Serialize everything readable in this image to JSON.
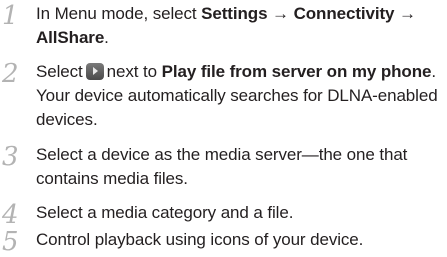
{
  "steps": [
    {
      "number": "1",
      "segments": [
        {
          "text": "In Menu mode, select ",
          "bold": false
        },
        {
          "text": "Settings",
          "bold": true
        },
        {
          "text": " → ",
          "bold": false
        },
        {
          "text": "Connectivity",
          "bold": true
        },
        {
          "text": " → ",
          "bold": false
        },
        {
          "text": "AllShare",
          "bold": true
        },
        {
          "text": ".",
          "bold": false
        }
      ]
    },
    {
      "number": "2",
      "segments": [
        {
          "text": "Select",
          "bold": false
        },
        {
          "icon": "play-arrow-icon"
        },
        {
          "text": "next to ",
          "bold": false
        },
        {
          "text": "Play file from server on my phone",
          "bold": true
        },
        {
          "text": ". Your device automatically searches for DLNA-enabled devices.",
          "bold": false
        }
      ]
    },
    {
      "number": "3",
      "segments": [
        {
          "text": "Select a device as the media server—the one that contains media files.",
          "bold": false
        }
      ]
    },
    {
      "number": "4",
      "segments": [
        {
          "text": "Select a media category and a file.",
          "bold": false
        }
      ]
    },
    {
      "number": "5",
      "segments": [
        {
          "text": "Control playback using icons of your device.",
          "bold": false
        }
      ]
    }
  ]
}
